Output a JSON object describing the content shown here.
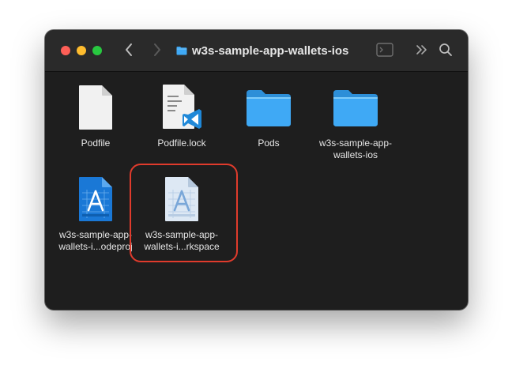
{
  "window": {
    "title": "w3s-sample-app-wallets-ios"
  },
  "items": [
    {
      "name": "Podfile",
      "line1": "Podfile",
      "line2": ""
    },
    {
      "name": "Podfile.lock",
      "line1": "Podfile.lock",
      "line2": ""
    },
    {
      "name": "Pods",
      "line1": "Pods",
      "line2": ""
    },
    {
      "name": "w3s-sample-app-wallets-ios",
      "line1": "w3s-sample-app-",
      "line2": "wallets-ios"
    },
    {
      "name": "w3s-sample-app-wallets-i...odeproj",
      "line1": "w3s-sample-app-",
      "line2": "wallets-i...odeproj"
    },
    {
      "name": "w3s-sample-app-wallets-i...rkspace",
      "line1": "w3s-sample-app-",
      "line2": "wallets-i...rkspace"
    }
  ],
  "colors": {
    "folder_blue": "#3fa9f5",
    "highlight_red": "#e03b2c",
    "window_bg": "#1e1e1e"
  }
}
